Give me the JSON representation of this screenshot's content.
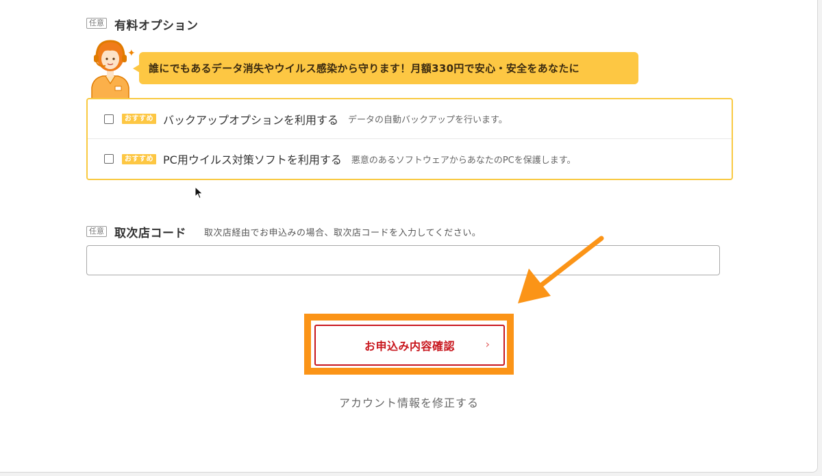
{
  "paid_options": {
    "tag": "任意",
    "title": "有料オプション",
    "bubble_text": "誰にでもあるデータ消失やウイルス感染から守ります！月額330円で安心・安全をあなたに",
    "items": [
      {
        "badge": "おすすめ",
        "label": "バックアップオプションを利用する",
        "description": "データの自動バックアップを行います。",
        "checked": false
      },
      {
        "badge": "おすすめ",
        "label": "PC用ウイルス対策ソフトを利用する",
        "description": "悪意のあるソフトウェアからあなたのPCを保護します。",
        "checked": false
      }
    ]
  },
  "agency_code": {
    "tag": "任意",
    "title": "取次店コード",
    "hint": "取次店経由でお申込みの場合、取次店コードを入力してください。",
    "value": "",
    "placeholder": ""
  },
  "actions": {
    "confirm_label": "お申込み内容確認",
    "confirm_chevron": "›",
    "edit_account_label": "アカウント情報を修正する"
  },
  "icons": {
    "mascot": "support-operator-icon",
    "sparkle": "sparkle-icon",
    "annotation_arrow": "arrow-icon",
    "cursor": "mouse-pointer-icon"
  },
  "colors": {
    "accent_yellow": "#fdc743",
    "highlight_orange": "#fb9417",
    "button_red": "#c8161d"
  }
}
